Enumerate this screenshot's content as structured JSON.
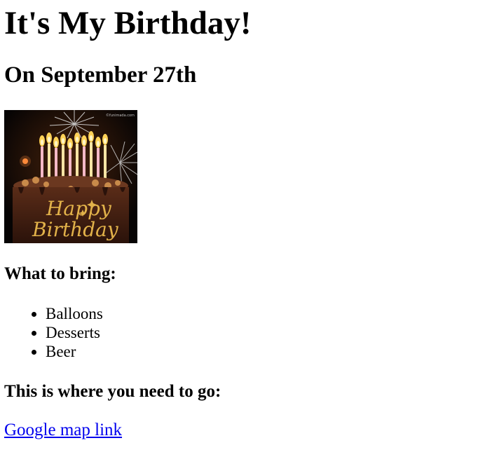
{
  "page": {
    "title": "It's My Birthday!",
    "subtitle": "On September 27th",
    "image": {
      "icon": "birthday-cake-image",
      "watermark": "©funimada.com",
      "lettering_line1": "Happy",
      "lettering_line2": "Birthday"
    },
    "bring_heading": "What to bring:",
    "bring_items": [
      "Balloons",
      "Desserts",
      "Beer"
    ],
    "where_heading": "This is where you need to go:",
    "map_link_label": "Google map link",
    "colors": {
      "link": "#0000ee",
      "cake_frosting": "#4a2414",
      "lettering": "#e2b24a",
      "background": "#ffffff"
    }
  }
}
